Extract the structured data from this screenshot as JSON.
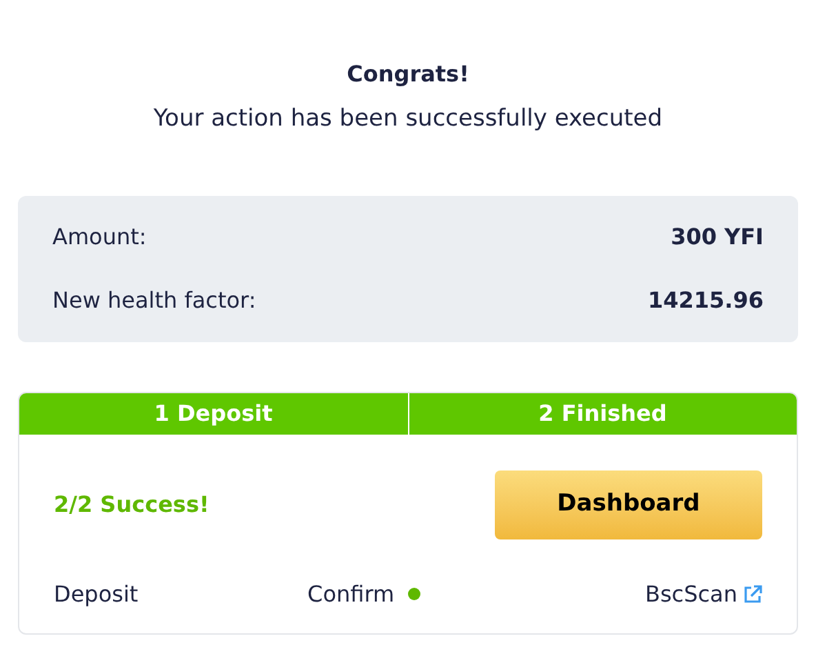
{
  "title": "Congrats!",
  "subtitle": "Your action has been successfully executed",
  "details": [
    {
      "label": "Amount:",
      "value": "300 YFI"
    },
    {
      "label": "New health factor:",
      "value": "14215.96"
    }
  ],
  "steps": [
    {
      "label": "1 Deposit",
      "done": true
    },
    {
      "label": "2 Finished",
      "done": true
    }
  ],
  "result": {
    "message": "2/2 Success!",
    "button": "Dashboard"
  },
  "footer": {
    "action": "Deposit",
    "status": "Confirm",
    "confirmed": true,
    "link": "BscScan"
  }
}
